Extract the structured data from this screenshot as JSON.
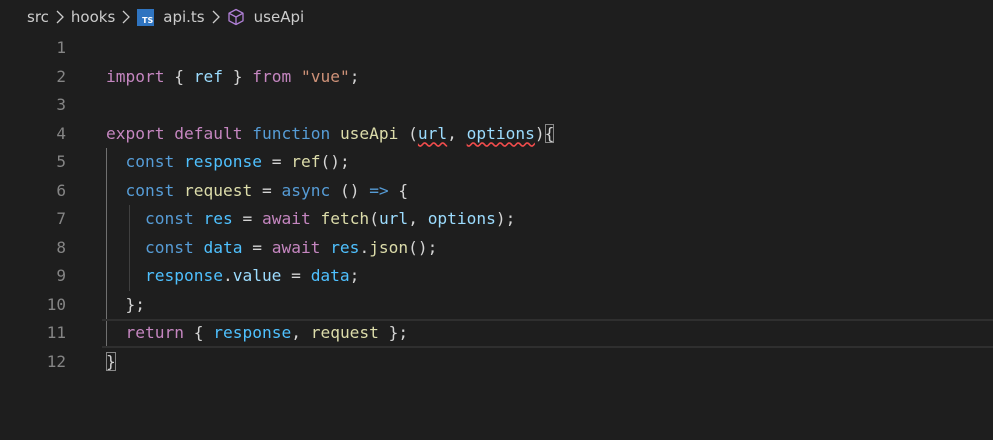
{
  "breadcrumb": {
    "items": [
      {
        "label": "src",
        "icon": null
      },
      {
        "label": "hooks",
        "icon": null
      },
      {
        "label": "api.ts",
        "icon": "typescript-file-icon",
        "icon_text": "TS",
        "icon_color": "#2f74c0"
      },
      {
        "label": "useApi",
        "icon": "symbol-method-cube-icon",
        "icon_color": "#b180d7"
      }
    ]
  },
  "editor": {
    "current_line": 11,
    "line_numbers": [
      "1",
      "2",
      "3",
      "4",
      "5",
      "6",
      "7",
      "8",
      "9",
      "10",
      "11",
      "12"
    ],
    "tokens": {
      "l2_import": "import",
      "l2_lb": "{ ",
      "l2_ref": "ref",
      "l2_rb": " }",
      "l2_from": "from",
      "l2_vue": "\"vue\"",
      "l2_semi": ";",
      "l4_export": "export",
      "l4_default": "default",
      "l4_function": "function",
      "l4_useapi": "useApi",
      "l4_lp": "(",
      "l4_url": "url",
      "l4_comma": ", ",
      "l4_options": "options",
      "l4_rp": ")",
      "l4_brace": "{",
      "l5_const": "const",
      "l5_response": "response",
      "l5_eq": " = ",
      "l5_ref": "ref",
      "l5_tail": "();",
      "l6_const": "const",
      "l6_request": "request",
      "l6_eq": " = ",
      "l6_async": "async",
      "l6_paren": " () ",
      "l6_arrow": "=>",
      "l6_brace": " {",
      "l7_const": "const",
      "l7_res": "res",
      "l7_eq": " = ",
      "l7_await": "await",
      "l7_fetch": "fetch",
      "l7_lp": "(",
      "l7_url": "url",
      "l7_comma": ", ",
      "l7_options": "options",
      "l7_tail": ");",
      "l8_const": "const",
      "l8_data": "data",
      "l8_eq": " = ",
      "l8_await": "await",
      "l8_res": "res",
      "l8_dot": ".",
      "l8_json": "json",
      "l8_tail": "();",
      "l9_response": "response",
      "l9_dot": ".",
      "l9_value": "value",
      "l9_eq": " = ",
      "l9_data": "data",
      "l9_semi": ";",
      "l10_close": "};",
      "l11_return": "return",
      "l11_lb": " { ",
      "l11_response": "response",
      "l11_comma": ", ",
      "l11_request": "request",
      "l11_rb": " };",
      "l12_brace": "}"
    }
  }
}
